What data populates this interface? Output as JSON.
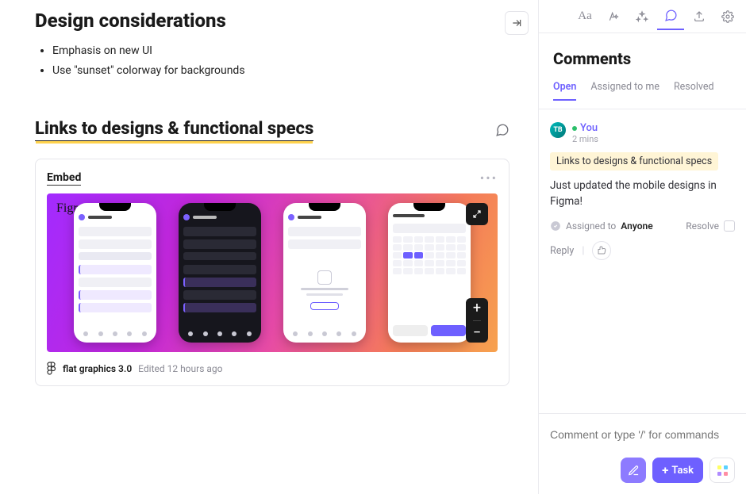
{
  "main": {
    "heading1": "Design considerations",
    "bullets": [
      "Emphasis on new UI",
      "Use \"sunset\" colorway for backgrounds"
    ],
    "heading2": "Links to designs & functional specs",
    "embed": {
      "label": "Embed",
      "watermark": "Figma",
      "file_name": "flat graphics 3.0",
      "edited": "Edited 12 hours ago"
    }
  },
  "toolbar": {
    "collapse": "→|",
    "items": [
      "text-style",
      "ai",
      "sparkles",
      "comments",
      "export",
      "settings"
    ],
    "active": "comments"
  },
  "panel": {
    "title": "Comments",
    "tabs": {
      "open": "Open",
      "assigned": "Assigned to me",
      "resolved": "Resolved"
    },
    "thread": {
      "avatar_initials": "TB",
      "author": "You",
      "timestamp": "2 mins",
      "reference": "Links to designs & functional specs",
      "message": "Just updated the mobile designs in Figma!",
      "assigned_label": "Assigned to",
      "assigned_to": "Anyone",
      "resolve_label": "Resolve",
      "reply_label": "Reply"
    },
    "composer_placeholder": "Comment or type '/' for commands",
    "task_button": "Task"
  }
}
